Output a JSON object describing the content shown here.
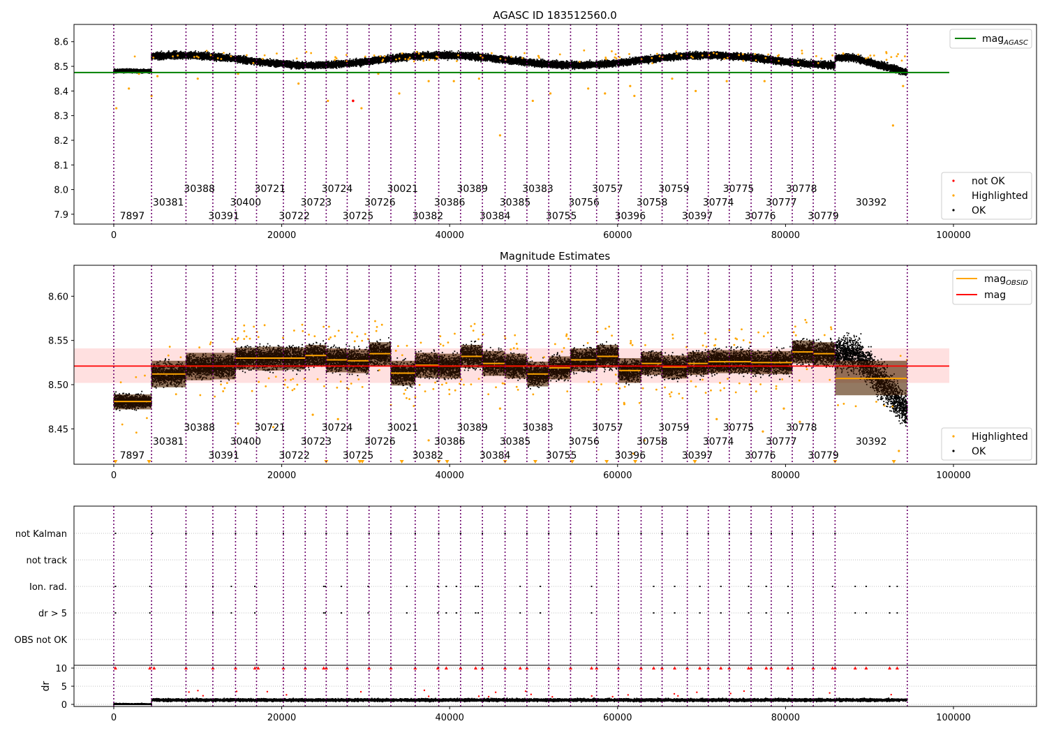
{
  "chart_data": [
    {
      "type": "scatter",
      "title": "AGASC ID 183512560.0",
      "xlabel": "",
      "ylabel": "",
      "xlim": [
        -5000,
        110000
      ],
      "ylim": [
        7.86,
        8.67
      ],
      "x_ticks": [
        "0",
        "20000",
        "40000",
        "60000",
        "80000",
        "100000"
      ],
      "y_ticks": [
        "7.9",
        "8.0",
        "8.1",
        "8.2",
        "8.3",
        "8.4",
        "8.5",
        "8.6"
      ],
      "grid": false,
      "mag_agasc": 8.475,
      "mag_agasc_line_x": [
        -5000,
        99500
      ],
      "legend_top": {
        "position": "top-right",
        "entries": [
          {
            "name": "magAGASC",
            "label_main": "mag",
            "label_sub": "AGASC",
            "color": "#008000"
          }
        ]
      },
      "legend_bottom": {
        "position": "bottom-right",
        "entries": [
          {
            "name": "not OK",
            "color": "#ff0000"
          },
          {
            "name": "Highlighted",
            "color": "#ffa500"
          },
          {
            "name": "OK",
            "color": "#000000"
          }
        ]
      },
      "series": [
        {
          "name": "OK",
          "color": "#000000",
          "description_levels": "dense band of points per observation, about 8.48 for obsid 7897, 8.51–8.56 afterwards, dropping to about 8.47 near the end"
        },
        {
          "name": "Highlighted",
          "color": "#ffa500",
          "points": [
            [
              300,
              8.33
            ],
            [
              1800,
              8.41
            ],
            [
              3000,
              8.47
            ],
            [
              4500,
              8.38
            ],
            [
              5200,
              8.46
            ],
            [
              10000,
              8.45
            ],
            [
              14800,
              8.47
            ],
            [
              22000,
              8.43
            ],
            [
              25500,
              8.36
            ],
            [
              29500,
              8.33
            ],
            [
              31500,
              8.47
            ],
            [
              34000,
              8.39
            ],
            [
              37500,
              8.44
            ],
            [
              40500,
              8.44
            ],
            [
              43500,
              8.45
            ],
            [
              46000,
              8.22
            ],
            [
              49900,
              8.36
            ],
            [
              52000,
              8.39
            ],
            [
              56500,
              8.41
            ],
            [
              58500,
              8.39
            ],
            [
              61500,
              8.42
            ],
            [
              62000,
              8.38
            ],
            [
              66500,
              8.45
            ],
            [
              69300,
              8.4
            ],
            [
              73000,
              8.44
            ],
            [
              77500,
              8.44
            ],
            [
              92800,
              8.26
            ],
            [
              94000,
              8.42
            ]
          ]
        },
        {
          "name": "not OK",
          "color": "#ff0000",
          "points": [
            [
              28500,
              8.36
            ]
          ]
        }
      ],
      "obsid_labels": [
        {
          "x": 2200,
          "y": 7.88,
          "text": "7897"
        },
        {
          "x": 6500,
          "y": 7.935,
          "text": "30381"
        },
        {
          "x": 10200,
          "y": 7.99,
          "text": "30388"
        },
        {
          "x": 13100,
          "y": 7.88,
          "text": "30391"
        },
        {
          "x": 15700,
          "y": 7.935,
          "text": "30400"
        },
        {
          "x": 18600,
          "y": 7.99,
          "text": "30721"
        },
        {
          "x": 21500,
          "y": 7.88,
          "text": "30722"
        },
        {
          "x": 24100,
          "y": 7.935,
          "text": "30723"
        },
        {
          "x": 26600,
          "y": 7.99,
          "text": "30724"
        },
        {
          "x": 29100,
          "y": 7.88,
          "text": "30725"
        },
        {
          "x": 31700,
          "y": 7.935,
          "text": "30726"
        },
        {
          "x": 34400,
          "y": 7.99,
          "text": "30021"
        },
        {
          "x": 37400,
          "y": 7.88,
          "text": "30382"
        },
        {
          "x": 40000,
          "y": 7.935,
          "text": "30386"
        },
        {
          "x": 42700,
          "y": 7.99,
          "text": "30389"
        },
        {
          "x": 45400,
          "y": 7.88,
          "text": "30384"
        },
        {
          "x": 47800,
          "y": 7.935,
          "text": "30385"
        },
        {
          "x": 50500,
          "y": 7.99,
          "text": "30383"
        },
        {
          "x": 53300,
          "y": 7.88,
          "text": "30755"
        },
        {
          "x": 56000,
          "y": 7.935,
          "text": "30756"
        },
        {
          "x": 58800,
          "y": 7.99,
          "text": "30757"
        },
        {
          "x": 61500,
          "y": 7.88,
          "text": "30396"
        },
        {
          "x": 64100,
          "y": 7.935,
          "text": "30758"
        },
        {
          "x": 66700,
          "y": 7.99,
          "text": "30759"
        },
        {
          "x": 69500,
          "y": 7.88,
          "text": "30397"
        },
        {
          "x": 72000,
          "y": 7.935,
          "text": "30774"
        },
        {
          "x": 74400,
          "y": 7.99,
          "text": "30775"
        },
        {
          "x": 77000,
          "y": 7.88,
          "text": "30776"
        },
        {
          "x": 79500,
          "y": 7.935,
          "text": "30777"
        },
        {
          "x": 81900,
          "y": 7.99,
          "text": "30778"
        },
        {
          "x": 84500,
          "y": 7.88,
          "text": "30779"
        },
        {
          "x": 90200,
          "y": 7.935,
          "text": "30392"
        }
      ]
    },
    {
      "type": "scatter",
      "title": "Magnitude Estimates",
      "xlabel": "",
      "ylabel": "",
      "xlim": [
        -5000,
        110000
      ],
      "ylim": [
        8.41,
        8.635
      ],
      "x_ticks": [
        "0",
        "20000",
        "40000",
        "60000",
        "80000",
        "100000"
      ],
      "y_ticks": [
        "8.45",
        "8.50",
        "8.55",
        "8.60"
      ],
      "grid": false,
      "mag": 8.521,
      "mag_band": [
        8.502,
        8.541
      ],
      "mag_line_x": [
        -5000,
        99500
      ],
      "legend_top": {
        "position": "top-right",
        "entries": [
          {
            "name": "magOBSID",
            "label_main": "mag",
            "label_sub": "OBSID",
            "color": "#ffa500"
          },
          {
            "name": "mag",
            "label_main": "mag",
            "label_sub": "",
            "color": "#ff0000"
          }
        ]
      },
      "legend_bottom": {
        "position": "bottom-right",
        "entries": [
          {
            "name": "Highlighted",
            "color": "#ffa500"
          },
          {
            "name": "OK",
            "color": "#000000"
          }
        ]
      },
      "mag_obsid": [
        {
          "x0": 0,
          "x1": 4500,
          "mag": 8.481,
          "lo": 8.472,
          "hi": 8.489
        },
        {
          "x0": 4500,
          "x1": 8600,
          "mag": 8.512,
          "lo": 8.497,
          "hi": 8.527
        },
        {
          "x0": 8600,
          "x1": 11800,
          "mag": 8.521,
          "lo": 8.505,
          "hi": 8.536
        },
        {
          "x0": 11800,
          "x1": 14500,
          "mag": 8.521,
          "lo": 8.506,
          "hi": 8.536
        },
        {
          "x0": 14500,
          "x1": 17000,
          "mag": 8.53,
          "lo": 8.517,
          "hi": 8.542
        },
        {
          "x0": 17000,
          "x1": 20200,
          "mag": 8.53,
          "lo": 8.516,
          "hi": 8.543
        },
        {
          "x0": 20200,
          "x1": 22800,
          "mag": 8.53,
          "lo": 8.517,
          "hi": 8.542
        },
        {
          "x0": 22800,
          "x1": 25300,
          "mag": 8.533,
          "lo": 8.521,
          "hi": 8.545
        },
        {
          "x0": 25300,
          "x1": 27800,
          "mag": 8.528,
          "lo": 8.514,
          "hi": 8.541
        },
        {
          "x0": 27800,
          "x1": 30400,
          "mag": 8.527,
          "lo": 8.513,
          "hi": 8.54
        },
        {
          "x0": 30400,
          "x1": 33000,
          "mag": 8.535,
          "lo": 8.521,
          "hi": 8.548
        },
        {
          "x0": 33000,
          "x1": 35900,
          "mag": 8.513,
          "lo": 8.499,
          "hi": 8.527
        },
        {
          "x0": 35900,
          "x1": 38700,
          "mag": 8.522,
          "lo": 8.508,
          "hi": 8.536
        },
        {
          "x0": 38700,
          "x1": 41300,
          "mag": 8.521,
          "lo": 8.507,
          "hi": 8.535
        },
        {
          "x0": 41300,
          "x1": 43900,
          "mag": 8.532,
          "lo": 8.519,
          "hi": 8.545
        },
        {
          "x0": 43900,
          "x1": 46600,
          "mag": 8.524,
          "lo": 8.51,
          "hi": 8.538
        },
        {
          "x0": 46600,
          "x1": 49200,
          "mag": 8.521,
          "lo": 8.507,
          "hi": 8.535
        },
        {
          "x0": 49200,
          "x1": 51800,
          "mag": 8.512,
          "lo": 8.498,
          "hi": 8.526
        },
        {
          "x0": 51800,
          "x1": 54400,
          "mag": 8.519,
          "lo": 8.506,
          "hi": 8.532
        },
        {
          "x0": 54400,
          "x1": 57500,
          "mag": 8.528,
          "lo": 8.515,
          "hi": 8.541
        },
        {
          "x0": 57500,
          "x1": 60100,
          "mag": 8.532,
          "lo": 8.519,
          "hi": 8.545
        },
        {
          "x0": 60100,
          "x1": 62800,
          "mag": 8.516,
          "lo": 8.502,
          "hi": 8.53
        },
        {
          "x0": 62800,
          "x1": 65300,
          "mag": 8.524,
          "lo": 8.511,
          "hi": 8.537
        },
        {
          "x0": 65300,
          "x1": 68300,
          "mag": 8.52,
          "lo": 8.507,
          "hi": 8.533
        },
        {
          "x0": 68300,
          "x1": 70800,
          "mag": 8.524,
          "lo": 8.511,
          "hi": 8.537
        },
        {
          "x0": 70800,
          "x1": 73300,
          "mag": 8.526,
          "lo": 8.513,
          "hi": 8.539
        },
        {
          "x0": 73300,
          "x1": 75900,
          "mag": 8.526,
          "lo": 8.513,
          "hi": 8.539
        },
        {
          "x0": 75900,
          "x1": 78300,
          "mag": 8.525,
          "lo": 8.512,
          "hi": 8.538
        },
        {
          "x0": 78300,
          "x1": 80800,
          "mag": 8.525,
          "lo": 8.512,
          "hi": 8.538
        },
        {
          "x0": 80800,
          "x1": 83300,
          "mag": 8.537,
          "lo": 8.524,
          "hi": 8.55
        },
        {
          "x0": 83300,
          "x1": 85900,
          "mag": 8.535,
          "lo": 8.522,
          "hi": 8.548
        },
        {
          "x0": 85900,
          "x1": 94500,
          "mag": 8.507,
          "lo": 8.488,
          "hi": 8.527
        }
      ],
      "series": [
        {
          "name": "OK",
          "color": "#000000",
          "description_levels": "dense band of points per observation around the orange mag_OBSID values"
        },
        {
          "name": "Highlighted",
          "color": "#ffa500",
          "points": [
            [
              14800,
              8.456
            ],
            [
              19000,
              8.452
            ],
            [
              23700,
              8.466
            ],
            [
              26700,
              8.461
            ],
            [
              37500,
              8.437
            ],
            [
              46000,
              8.473
            ],
            [
              60800,
              8.478
            ],
            [
              61900,
              8.422
            ],
            [
              63200,
              8.437
            ],
            [
              71800,
              8.461
            ],
            [
              77300,
              8.447
            ],
            [
              79800,
              8.473
            ],
            [
              81700,
              8.458
            ],
            [
              93500,
              8.425
            ]
          ]
        }
      ],
      "clipped_marker_x": [
        200,
        4200,
        25300,
        29300,
        29600,
        34300,
        38700,
        39700,
        46600,
        50200,
        54600,
        58700,
        62100,
        69200,
        85900,
        92900
      ],
      "clipped_marker_color": "#ffa500",
      "obsid_labels_same_as_panel_1": true
    },
    {
      "type": "scatter",
      "title": "",
      "xlabel": "",
      "xlim": [
        -5000,
        110000
      ],
      "x_ticks": [
        "0",
        "20000",
        "40000",
        "60000",
        "80000",
        "100000"
      ],
      "flag_rows": [
        "not Kalman",
        "not track",
        "Ion. rad.",
        "dr > 5",
        "OBS not OK"
      ],
      "flag_points": {
        "not Kalman": [
          200,
          4600,
          8600,
          11800,
          14500,
          17000,
          20200,
          22800,
          25300,
          27800,
          30400,
          33000,
          35900,
          38700,
          41300,
          43900,
          46600,
          49200,
          51800,
          54400,
          57500,
          60100,
          62800,
          65300,
          68300,
          70800,
          73300,
          75900,
          78300,
          80800,
          83300,
          85900
        ],
        "not track": [],
        "Ion. rad.": [
          200,
          4300,
          8600,
          11800,
          14000,
          16800,
          25000,
          25200,
          27100,
          30300,
          34900,
          38600,
          39600,
          40800,
          43100,
          43400,
          48400,
          50800,
          56900,
          64300,
          66800,
          69800,
          72300,
          75600,
          77700,
          80300,
          85600,
          88300,
          89600,
          92400,
          93300
        ],
        "dr > 5": [
          200,
          4300,
          11800,
          14000,
          16800,
          25000,
          25200,
          27100,
          30300,
          34900,
          38600,
          39600,
          40800,
          43100,
          43400,
          48400,
          50800,
          56900,
          64300,
          66800,
          69800,
          72300,
          75600,
          77700,
          80300,
          88300,
          89600,
          92400,
          93300
        ],
        "OBS not OK": []
      },
      "dr_panel": {
        "ylabel": "dr",
        "y_ticks": [
          "0",
          "5",
          "10"
        ],
        "ylim": [
          -0.5,
          10.5
        ],
        "threshold": 5,
        "description": "dr values near 0 for obsid 7897, about 1–2 afterwards; values above 10 are drawn as red markers at 10",
        "clipped_red_x": [
          200,
          4300,
          4800,
          8600,
          11800,
          14500,
          16800,
          17200,
          20200,
          22800,
          25000,
          25300,
          27800,
          30400,
          33000,
          35900,
          38600,
          39600,
          41300,
          43100,
          43900,
          46600,
          48400,
          49200,
          51800,
          54400,
          56900,
          57500,
          60100,
          62800,
          64300,
          65300,
          66800,
          68300,
          69800,
          70800,
          72300,
          73300,
          75600,
          75900,
          77700,
          78300,
          80300,
          80800,
          83300,
          85600,
          85900,
          88300,
          89600,
          92400,
          93300
        ]
      }
    }
  ]
}
